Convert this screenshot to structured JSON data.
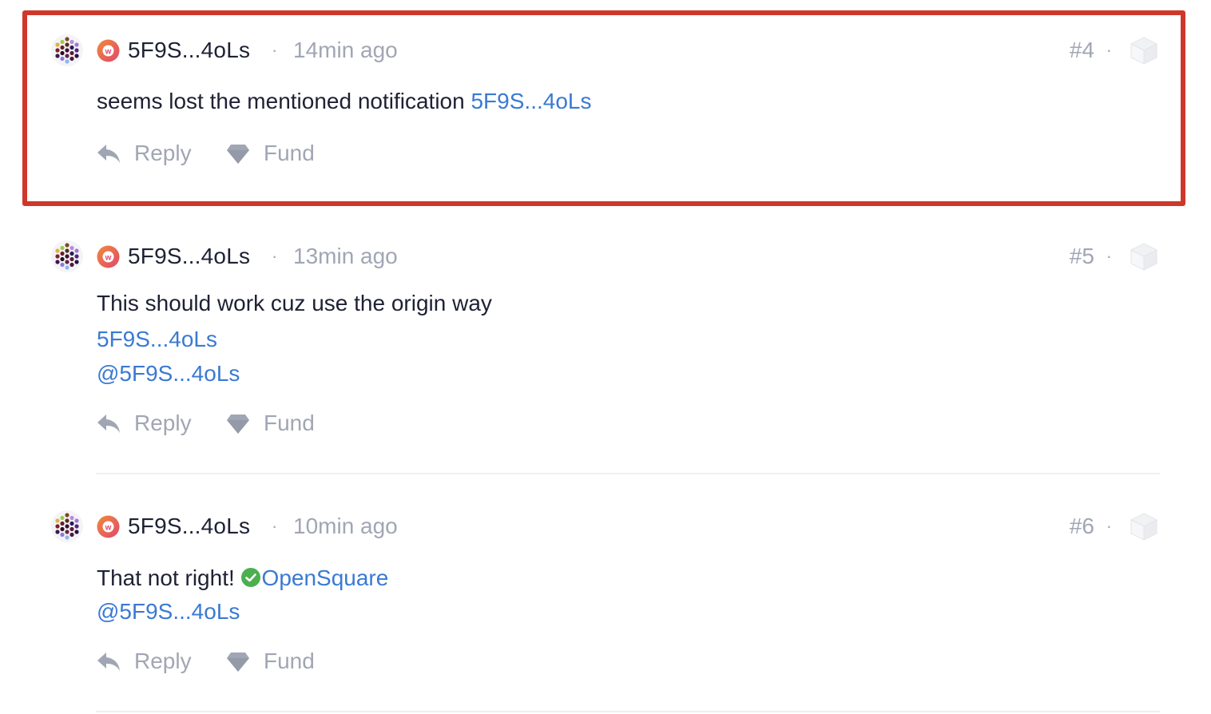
{
  "comments": [
    {
      "author": "5F9S...4oLs",
      "separator": "·",
      "time": "14min ago",
      "index": "#4",
      "line1_text": "seems lost the mentioned notification ",
      "line1_link": "5F9S...4oLs",
      "reply_label": "Reply",
      "fund_label": "Fund"
    },
    {
      "author": "5F9S...4oLs",
      "separator": "·",
      "time": "13min ago",
      "index": "#5",
      "line1_text": "This should work cuz use the origin way",
      "line2_link": "5F9S...4oLs",
      "line3_link": "@5F9S...4oLs",
      "reply_label": "Reply",
      "fund_label": "Fund"
    },
    {
      "author": "5F9S...4oLs",
      "separator": "·",
      "time": "10min ago",
      "index": "#6",
      "line1_text": "That not right! ",
      "line1_link": "OpenSquare",
      "line2_link": "@5F9S...4oLs",
      "reply_label": "Reply",
      "fund_label": "Fund"
    }
  ],
  "colors": {
    "highlight_border": "#d0372b",
    "link": "#3a7ad3",
    "muted": "#a1a6b4",
    "verified": "#4caf50",
    "badge": "#e8574e"
  },
  "icons": {
    "avatar": "identicon-avatar",
    "badge": "w-badge-icon",
    "cube": "cube-icon",
    "reply": "reply-icon",
    "fund": "diamond-icon",
    "verified": "check-circle-icon"
  }
}
